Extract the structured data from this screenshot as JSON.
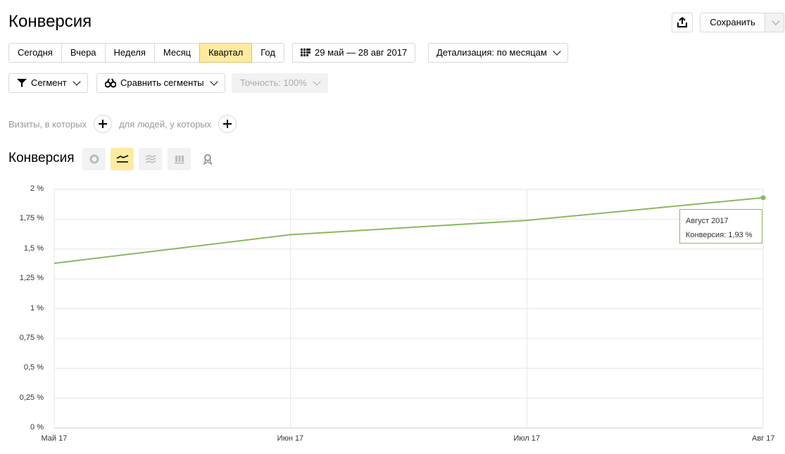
{
  "page_title": "Конверсия",
  "toolbar": {
    "share_icon": "share-icon",
    "save_label": "Сохранить",
    "save_dropdown_icon": "chevron-down-icon"
  },
  "period_buttons": [
    {
      "label": "Сегодня",
      "active": false
    },
    {
      "label": "Вчера",
      "active": false
    },
    {
      "label": "Неделя",
      "active": false
    },
    {
      "label": "Месяц",
      "active": false
    },
    {
      "label": "Квартал",
      "active": true
    },
    {
      "label": "Год",
      "active": false
    }
  ],
  "date_range": {
    "icon": "calendar-icon",
    "label": "29 май — 28 авг 2017"
  },
  "detail": {
    "label": "Детализация: по месяцам"
  },
  "segment": {
    "icon": "filter-icon",
    "label": "Сегмент"
  },
  "compare": {
    "icon": "compare-segments-icon",
    "label": "Сравнить сегменты"
  },
  "accuracy": {
    "label": "Точность: 100%"
  },
  "filters": {
    "visits_label": "Визиты, в которых",
    "people_label": "для людей, у которых"
  },
  "section_title": "Конверсия",
  "viz_types": [
    {
      "icon": "pie-chart-icon",
      "active": false
    },
    {
      "icon": "line-chart-icon",
      "active": true
    },
    {
      "icon": "area-chart-icon",
      "active": false
    },
    {
      "icon": "bar-chart-icon",
      "active": false
    },
    {
      "icon": "map-icon",
      "active": false
    }
  ],
  "chart_data": {
    "type": "line",
    "x": [
      "Май 17",
      "Июн 17",
      "Июл 17",
      "Авг 17"
    ],
    "series": [
      {
        "values": [
          1.38,
          1.62,
          1.74,
          1.93
        ]
      }
    ],
    "y_ticks": [
      "2 %",
      "1,75 %",
      "1,5 %",
      "1,25 %",
      "1 %",
      "0,75 %",
      "0,5 %",
      "0,25 %",
      "0 %"
    ],
    "ylim": [
      0,
      2
    ],
    "grid": true,
    "color": "#8bb863",
    "tooltip": {
      "title": "Август 2017",
      "text": "Конверсия: 1,93 %"
    }
  },
  "colors": {
    "accent": "#ffeba0",
    "line": "#8bb863"
  }
}
